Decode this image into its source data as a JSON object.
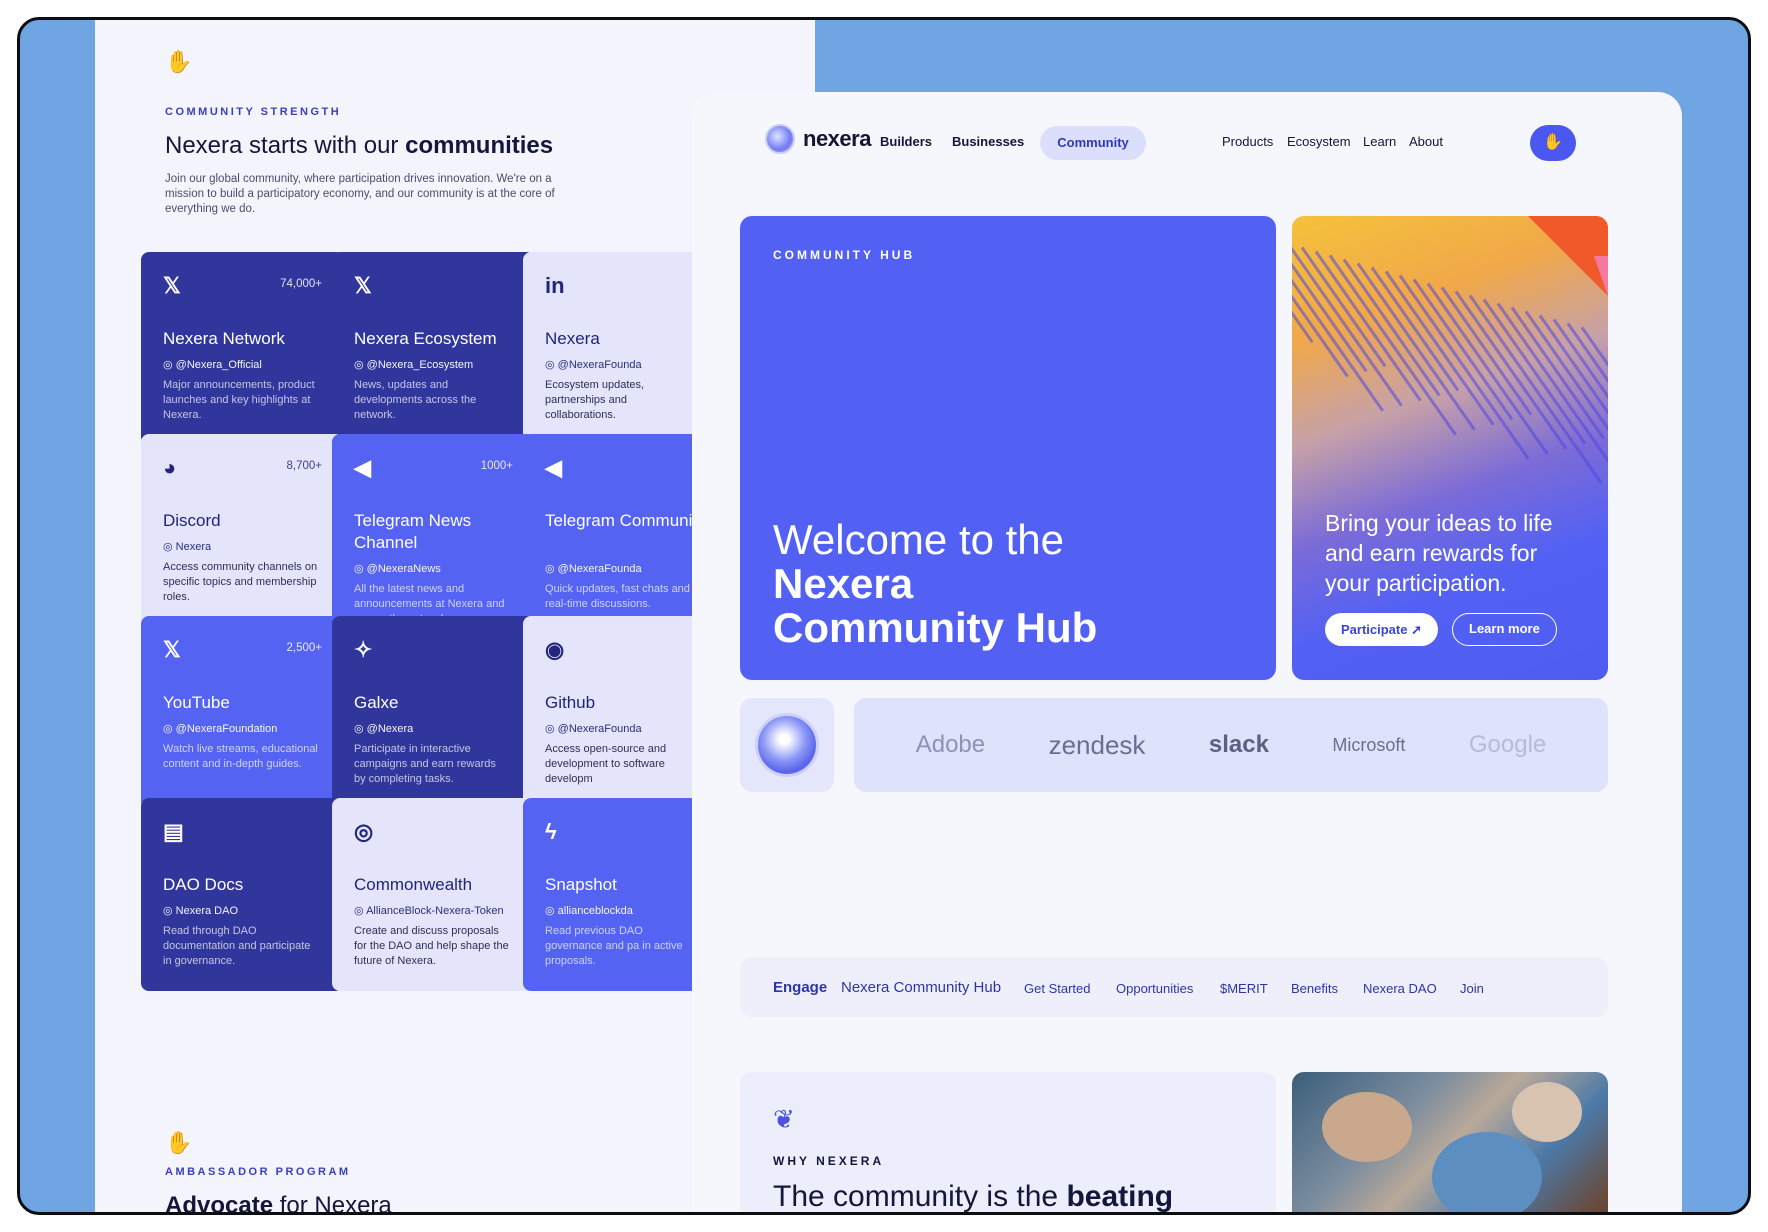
{
  "left": {
    "eyebrow": "COMMUNITY STRENGTH",
    "title_regular": "Nexera starts with our ",
    "title_bold": "communities",
    "description": "Join our global community, where participation drives innovation. We're on a mission to build a participatory economy, and our community is at the core of everything we do.",
    "cards": [
      {
        "icon": "x-icon",
        "glyph": "𝕏",
        "count": "74,000+",
        "name": "Nexera Network",
        "handle": "@Nexera_Official",
        "desc": "Major announcements, product launches and key highlights at Nexera."
      },
      {
        "icon": "x-icon",
        "glyph": "𝕏",
        "count": "",
        "name": "Nexera Ecosystem",
        "handle": "@Nexera_Ecosystem",
        "desc": "News, updates and developments across the network."
      },
      {
        "icon": "linkedin-icon",
        "glyph": "in",
        "count": "",
        "name": "Nexera",
        "handle": "@NexeraFounda",
        "desc": "Ecosystem updates, partnerships and collaborations."
      },
      {
        "icon": "discord-icon",
        "glyph": "◕",
        "count": "8,700+",
        "name": "Discord",
        "handle": "Nexera",
        "desc": "Access community channels on specific topics and membership roles."
      },
      {
        "icon": "telegram-icon",
        "glyph": "◀",
        "count": "1000+",
        "name": "Telegram News Channel",
        "handle": "@NexeraNews",
        "desc": "All the latest news and announcements at Nexera and across the network."
      },
      {
        "icon": "telegram-icon",
        "glyph": "◀",
        "count": "",
        "name": "Telegram Community",
        "handle": "@NexeraFounda",
        "desc": "Quick updates, fast chats and real-time discussions."
      },
      {
        "icon": "x-icon",
        "glyph": "𝕏",
        "count": "2,500+",
        "name": "YouTube",
        "handle": "@NexeraFoundation",
        "desc": "Watch live streams, educational content and in-depth guides."
      },
      {
        "icon": "galxe-icon",
        "glyph": "✧",
        "count": "",
        "name": "Galxe",
        "handle": "@Nexera",
        "desc": "Participate in interactive campaigns and earn rewards by completing tasks."
      },
      {
        "icon": "github-icon",
        "glyph": "◉",
        "count": "",
        "name": "Github",
        "handle": "@NexeraFounda",
        "desc": "Access open-source and development to software developm"
      },
      {
        "icon": "docs-icon",
        "glyph": "▤",
        "count": "",
        "name": "DAO Docs",
        "handle": "Nexera DAO",
        "desc": "Read through DAO documentation and participate in governance."
      },
      {
        "icon": "commonwealth-icon",
        "glyph": "◎",
        "count": "",
        "name": "Commonwealth",
        "handle": "AllianceBlock-Nexera-Token",
        "desc": "Create and discuss proposals for the DAO and help shape the future of Nexera."
      },
      {
        "icon": "lightning-icon",
        "glyph": "ϟ",
        "count": "",
        "name": "Snapshot",
        "handle": "allianceblockda",
        "desc": "Read previous DAO governance and pa in active proposals."
      }
    ],
    "amb_eyebrow": "AMBASSADOR PROGRAM",
    "amb_title_bold": "Advocate",
    "amb_title_regular": " for Nexera"
  },
  "nav": {
    "logo": "nexera",
    "builders": "Builders",
    "businesses": "Businesses",
    "community": "Community",
    "products": "Products",
    "ecosystem": "Ecosystem",
    "learn": "Learn",
    "about": "About"
  },
  "hub": {
    "eyebrow": "COMMUNITY HUB",
    "line1": "Welcome to the",
    "line2": "Nexera",
    "line3": "Community Hub"
  },
  "promo": {
    "text": "Bring your ideas to life and earn rewards for your participation.",
    "participate": "Participate",
    "learn_more": "Learn more"
  },
  "logos": [
    "Adobe",
    "zendesk",
    "slack",
    "Microsoft",
    "Google"
  ],
  "subnav": {
    "engage": "Engage",
    "hub": "Nexera Community Hub",
    "items": [
      "Get Started",
      "Opportunities",
      "$MERIT",
      "Benefits",
      "Nexera DAO",
      "Join"
    ]
  },
  "why": {
    "eyebrow": "WHY NEXERA",
    "title_regular": "The community is the ",
    "title_bold": "beating"
  },
  "colors": {
    "accent": "#5261f4",
    "dark_card": "#31369c",
    "light_card": "#e4e5fb",
    "backdrop": "#6fa5e2"
  }
}
